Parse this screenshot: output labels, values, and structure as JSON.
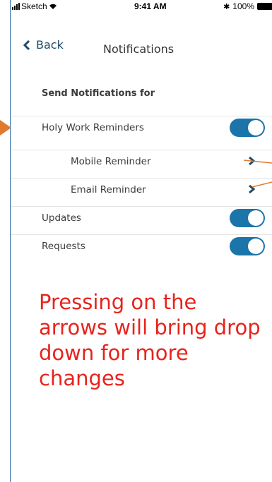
{
  "status_bar": {
    "carrier": "Sketch",
    "time": "9:41 AM",
    "battery": "100%"
  },
  "nav": {
    "back_label": "Back",
    "title": "Notifications"
  },
  "settings": {
    "section_header": "Send Notifications for",
    "rows": [
      {
        "label": "Holy Work Reminders",
        "control": "toggle",
        "on": true
      },
      {
        "label": "Mobile Reminder",
        "control": "chevron"
      },
      {
        "label": "Email Reminder",
        "control": "chevron"
      },
      {
        "label": "Updates",
        "control": "toggle",
        "on": true
      },
      {
        "label": "Requests",
        "control": "toggle",
        "on": true
      }
    ]
  },
  "annotation": {
    "text": "Pressing on the\narrows will bring drop\ndown for more\nchanges"
  },
  "colors": {
    "toggle_on": "#1b75a8",
    "annotation_text": "#e8231c",
    "annotation_arrow": "#e07a2e",
    "back_button": "#1f4a66"
  }
}
